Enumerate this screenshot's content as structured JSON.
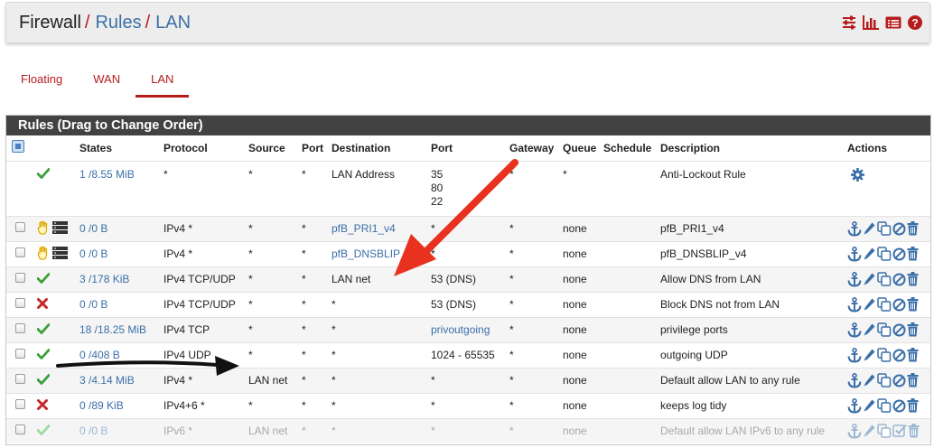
{
  "breadcrumb": {
    "root": "Firewall",
    "sep": "/",
    "level2": "Rules",
    "level3": "LAN"
  },
  "header_icons": [
    "sliders-icon",
    "bar-chart-icon",
    "list-icon",
    "help-icon"
  ],
  "tabs": [
    {
      "label": "Floating",
      "active": false
    },
    {
      "label": "WAN",
      "active": false
    },
    {
      "label": "LAN",
      "active": true
    }
  ],
  "panel_title": "Rules (Drag to Change Order)",
  "columns": {
    "states": "States",
    "protocol": "Protocol",
    "source": "Source",
    "port": "Port",
    "destination": "Destination",
    "dport": "Port",
    "gateway": "Gateway",
    "queue": "Queue",
    "schedule": "Schedule",
    "description": "Description",
    "actions": "Actions"
  },
  "colors": {
    "accent": "#b71c1c",
    "link": "#3b6fa8",
    "pass": "#3a9f3a",
    "block": "#c62828",
    "heading_bg": "#424242"
  },
  "rules": [
    {
      "status": "pass",
      "states": "1 /8.55 MiB",
      "protocol": "*",
      "source": "*",
      "sport": "*",
      "destination": "LAN Address",
      "dports": [
        "35",
        "80",
        "22"
      ],
      "gateway": "*",
      "queue": "*",
      "schedule": "",
      "description": "Anti-Lockout Rule"
    },
    {
      "status": "hand",
      "states": "0 /0 B",
      "protocol": "IPv4 *",
      "source": "*",
      "sport": "*",
      "destination": "pfB_PRI1_v4",
      "dport": "*",
      "gateway": "*",
      "queue": "none",
      "schedule": "",
      "description": "pfB_PRI1_v4"
    },
    {
      "status": "hand",
      "states": "0 /0 B",
      "protocol": "IPv4 *",
      "source": "*",
      "sport": "*",
      "destination": "pfB_DNSBLIP",
      "dport": "*",
      "gateway": "*",
      "queue": "none",
      "schedule": "",
      "description": "pfB_DNSBLIP_v4"
    },
    {
      "status": "pass",
      "states": "3 /178 KiB",
      "protocol": "IPv4 TCP/UDP",
      "source": "*",
      "sport": "*",
      "destination": "LAN net",
      "dport": "53 (DNS)",
      "gateway": "*",
      "queue": "none",
      "schedule": "",
      "description": "Allow DNS from LAN"
    },
    {
      "status": "block",
      "states": "0 /0 B",
      "protocol": "IPv4 TCP/UDP",
      "source": "*",
      "sport": "*",
      "destination": "*",
      "dport": "53 (DNS)",
      "gateway": "*",
      "queue": "none",
      "schedule": "",
      "description": "Block DNS not from LAN"
    },
    {
      "status": "pass",
      "states": "18 /18.25 MiB",
      "protocol": "IPv4 TCP",
      "source": "*",
      "sport": "*",
      "destination": "*",
      "dport": "privoutgoing",
      "gateway": "*",
      "queue": "none",
      "schedule": "",
      "description": "privilege ports"
    },
    {
      "status": "pass",
      "states": "0 /408 B",
      "protocol": "IPv4 UDP",
      "source": "*",
      "sport": "*",
      "destination": "*",
      "dport": "1024 - 65535",
      "gateway": "*",
      "queue": "none",
      "schedule": "",
      "description": "outgoing UDP"
    },
    {
      "status": "pass",
      "states": "3 /4.14 MiB",
      "protocol": "IPv4 *",
      "source": "LAN net",
      "sport": "*",
      "destination": "*",
      "dport": "*",
      "gateway": "*",
      "queue": "none",
      "schedule": "",
      "description": "Default allow LAN to any rule"
    },
    {
      "status": "block",
      "states": "0 /89 KiB",
      "protocol": "IPv4+6 *",
      "source": "*",
      "sport": "*",
      "destination": "*",
      "dport": "*",
      "gateway": "*",
      "queue": "none",
      "schedule": "",
      "description": "keeps log tidy"
    },
    {
      "status": "pass-disabled",
      "states": "0 /0 B",
      "protocol": "IPv6 *",
      "source": "LAN net",
      "sport": "*",
      "destination": "*",
      "dport": "*",
      "gateway": "*",
      "queue": "none",
      "schedule": "",
      "description": "Default allow LAN IPv6 to any rule"
    }
  ],
  "annotations": [
    {
      "type": "arrow",
      "color": "#e8321f",
      "icon": "red-arrow"
    },
    {
      "type": "arrow",
      "color": "#111111",
      "icon": "black-arrow"
    }
  ]
}
